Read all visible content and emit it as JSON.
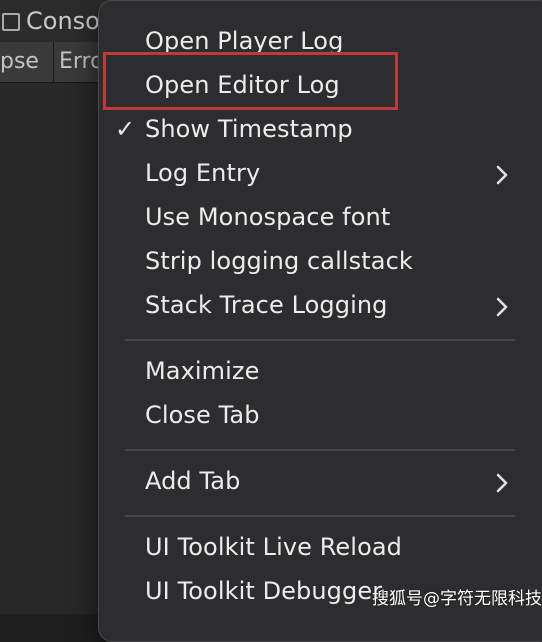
{
  "console_window": {
    "tab_title": "Console",
    "toolbar": {
      "collapse_label": "pse",
      "error_label": "Erro"
    }
  },
  "context_menu": {
    "items": [
      {
        "label": "Open Player Log",
        "checked": false,
        "submenu": false
      },
      {
        "label": "Open Editor Log",
        "checked": false,
        "submenu": false,
        "annotated": true
      },
      {
        "label": "Show Timestamp",
        "checked": true,
        "submenu": false
      },
      {
        "label": "Log Entry",
        "checked": false,
        "submenu": true
      },
      {
        "label": "Use Monospace font",
        "checked": false,
        "submenu": false
      },
      {
        "label": "Strip logging callstack",
        "checked": false,
        "submenu": false
      },
      {
        "label": "Stack Trace Logging",
        "checked": false,
        "submenu": true
      },
      {
        "label": "Maximize",
        "checked": false,
        "submenu": false
      },
      {
        "label": "Close Tab",
        "checked": false,
        "submenu": false
      },
      {
        "label": "Add Tab",
        "checked": false,
        "submenu": true
      },
      {
        "label": "UI Toolkit Live Reload",
        "checked": false,
        "submenu": false
      },
      {
        "label": "UI Toolkit Debugger",
        "checked": false,
        "submenu": false
      }
    ],
    "check_glyph": "✓"
  },
  "annotation": {
    "color": "#c0393b"
  },
  "watermark": {
    "text": "搜狐号@字符无限科技"
  }
}
